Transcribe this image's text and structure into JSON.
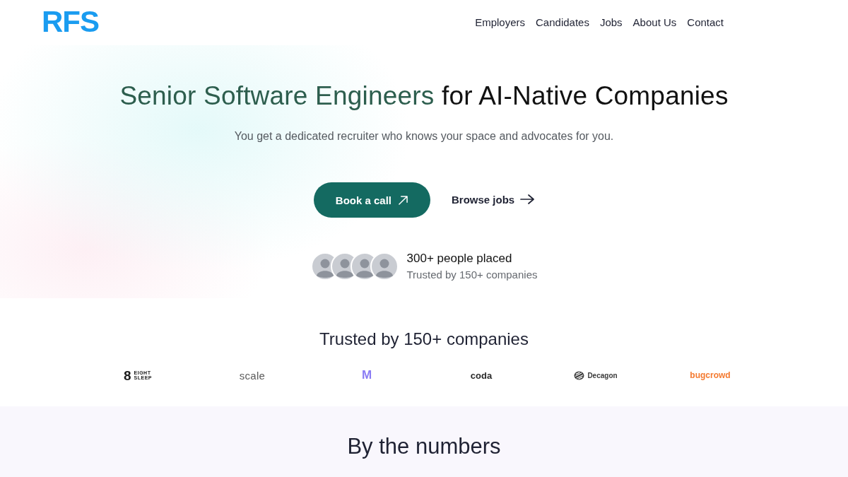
{
  "header": {
    "logo": "RFS",
    "nav": [
      "Employers",
      "Candidates",
      "Jobs",
      "About Us",
      "Contact"
    ]
  },
  "hero": {
    "title_highlight": "Senior Software Engineers",
    "title_rest": "for AI-Native Companies",
    "subtitle": "You get a dedicated recruiter who knows your space and advocates for you.",
    "primary_button": "Book a call",
    "secondary_link": "Browse jobs",
    "proof": {
      "headline": "300+ people placed",
      "subline": "Trusted by 150+ companies"
    }
  },
  "logos_section": {
    "heading": "Trusted by 150+ companies",
    "logos": [
      {
        "kind": "stacked",
        "mark": "8",
        "text": "EIGHT SLEEP",
        "color": "#1c1c1c"
      },
      {
        "kind": "text",
        "text": "scale",
        "color": "#5a5a5a"
      },
      {
        "kind": "text",
        "text": "M",
        "color": "#8a7cf4"
      },
      {
        "kind": "text",
        "text": "coda",
        "color": "#2a2a2a"
      },
      {
        "kind": "icon_text",
        "text": "Decagon",
        "color": "#3a3a3a"
      },
      {
        "kind": "text",
        "text": "bugcrowd",
        "color": "#f47a30"
      }
    ]
  },
  "numbers_section": {
    "heading": "By the numbers"
  }
}
